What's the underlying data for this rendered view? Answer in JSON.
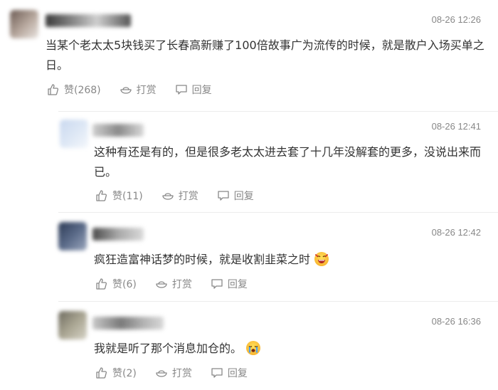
{
  "comments": [
    {
      "time": "08-26 12:26",
      "content": "当某个老太太5块钱买了长春高新赚了100倍故事广为流传的时候，就是散户入场买单之日。",
      "like_label": "赞(268)",
      "reward_label": "打赏",
      "reply_label": "回复"
    },
    {
      "time": "08-26 12:41",
      "content": "这种有还是有的，但是很多老太太进去套了十几年没解套的更多，没说出来而已。",
      "like_label": "赞(11)",
      "reward_label": "打赏",
      "reply_label": "回复"
    },
    {
      "time": "08-26 12:42",
      "content": "疯狂造富神话梦的时候，就是收割韭菜之时",
      "like_label": "赞(6)",
      "reward_label": "打赏",
      "reply_label": "回复"
    },
    {
      "time": "08-26 16:36",
      "content": "我就是听了那个消息加仓的。",
      "like_label": "赞(2)",
      "reward_label": "打赏",
      "reply_label": "回复"
    }
  ],
  "icons": {
    "like": "thumbs-up-icon",
    "reward": "ingot-icon",
    "reply": "speech-bubble-icon",
    "emoji_laugh": "laughing-emoji-icon",
    "emoji_cry": "crying-emoji-icon"
  },
  "colors": {
    "meta_text": "#888888",
    "body_text": "#333333",
    "divider": "#ececec"
  }
}
